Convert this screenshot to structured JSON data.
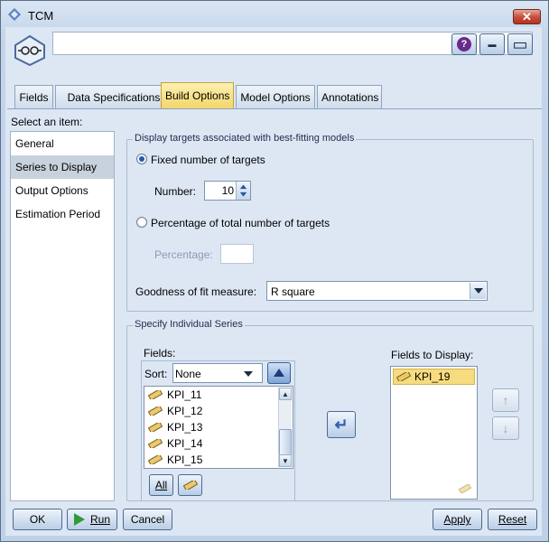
{
  "window": {
    "title": "TCM",
    "close_symbol": "✕"
  },
  "header": {
    "name_value": "",
    "help_symbol": "?",
    "minimize_symbol": "▬",
    "maximize_symbol": "▭"
  },
  "tabs": [
    {
      "label": "Fields",
      "active": false
    },
    {
      "label": "Data Specifications",
      "active": false
    },
    {
      "label": "Build Options",
      "active": true
    },
    {
      "label": "Model Options",
      "active": false
    },
    {
      "label": "Annotations",
      "active": false
    }
  ],
  "nav": {
    "heading": "Select an item:",
    "items": [
      {
        "label": "General",
        "selected": false
      },
      {
        "label": "Series to Display",
        "selected": true
      },
      {
        "label": "Output Options",
        "selected": false
      },
      {
        "label": "Estimation Period",
        "selected": false
      }
    ]
  },
  "display_targets": {
    "title": "Display targets associated with best-fitting models",
    "fixed_label": "Fixed number of targets",
    "fixed_selected": true,
    "number_label": "Number:",
    "number_value": "10",
    "percentage_option_label": "Percentage of total number of targets",
    "percentage_selected": false,
    "percentage_label": "Percentage:",
    "percentage_value": "",
    "goodness_label": "Goodness of fit measure:",
    "goodness_value": "R square"
  },
  "series": {
    "title": "Specify Individual Series",
    "fields_label": "Fields:",
    "sort_label": "Sort:",
    "sort_value": "None",
    "fields": [
      "KPI_11",
      "KPI_12",
      "KPI_13",
      "KPI_14",
      "KPI_15"
    ],
    "all_label": "All",
    "fields_to_display_label": "Fields to Display:",
    "fields_to_display": [
      "KPI_19"
    ]
  },
  "footer": {
    "ok": "OK",
    "run": "Run",
    "cancel": "Cancel",
    "apply": "Apply",
    "reset": "Reset"
  },
  "colors": {
    "active_tab": "#f3d66b",
    "selected_field": "#f6dc7e",
    "run_icon": "#2e9a3a",
    "close_button": "#c9513f"
  }
}
